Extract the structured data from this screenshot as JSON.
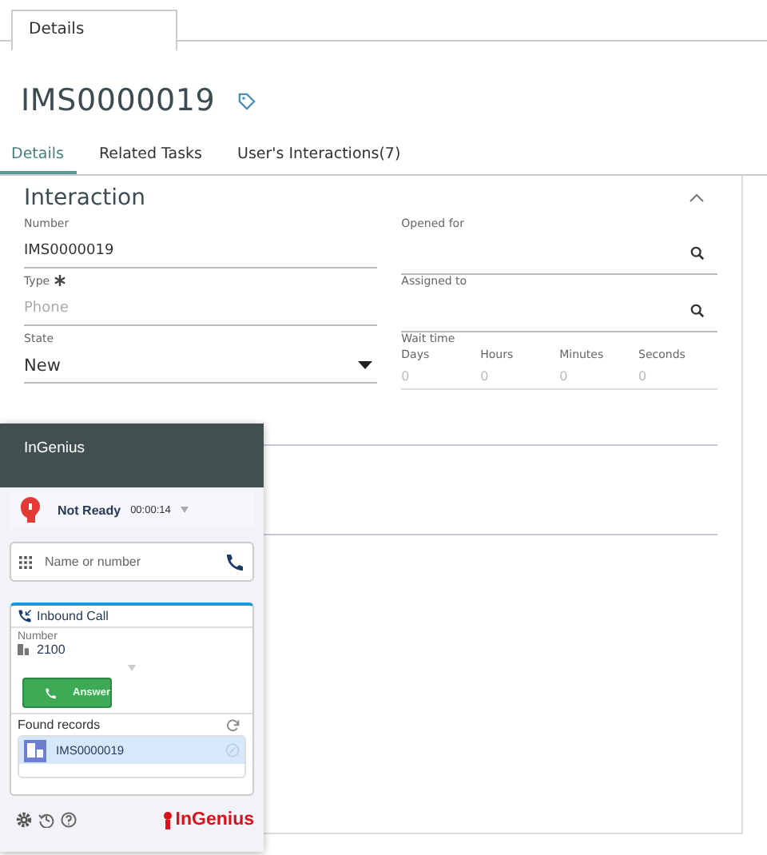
{
  "top_tabs": [
    {
      "label": "Details",
      "selected": true
    }
  ],
  "record": {
    "title": "IMS0000019"
  },
  "tabs": [
    {
      "label": "Details",
      "selected": true
    },
    {
      "label": "Related Tasks",
      "selected": false
    },
    {
      "label": "User's Interactions(7)",
      "selected": false
    }
  ],
  "section": {
    "title": "Interaction",
    "expanded": true,
    "left": [
      {
        "kind": "text",
        "label": "Number",
        "value": "IMS0000019",
        "required": false
      },
      {
        "kind": "text",
        "label": "Type",
        "placeholder": "Phone",
        "required": true
      },
      {
        "kind": "select",
        "label": "State",
        "value": "New",
        "required": false
      }
    ],
    "right": [
      {
        "kind": "lookup",
        "label": "Opened for"
      },
      {
        "kind": "lookup",
        "label": "Assigned to"
      },
      {
        "kind": "duration",
        "label": "Wait time",
        "units": [
          {
            "label": "Days",
            "placeholder": "0"
          },
          {
            "label": "Hours",
            "placeholder": "0"
          },
          {
            "label": "Minutes",
            "placeholder": "0"
          },
          {
            "label": "Seconds",
            "placeholder": "0"
          }
        ]
      }
    ]
  },
  "widget": {
    "title": "InGenius",
    "status": "Not Ready",
    "timer": "00:00:14",
    "dial_placeholder": "Name or number",
    "call": {
      "title": "Inbound Call",
      "number_label": "Number",
      "number": "2100",
      "answer": "Answer"
    },
    "found_label": "Found records",
    "records": [
      {
        "number": "IMS0000019",
        "selected": true
      }
    ],
    "brand": "InGenius"
  }
}
